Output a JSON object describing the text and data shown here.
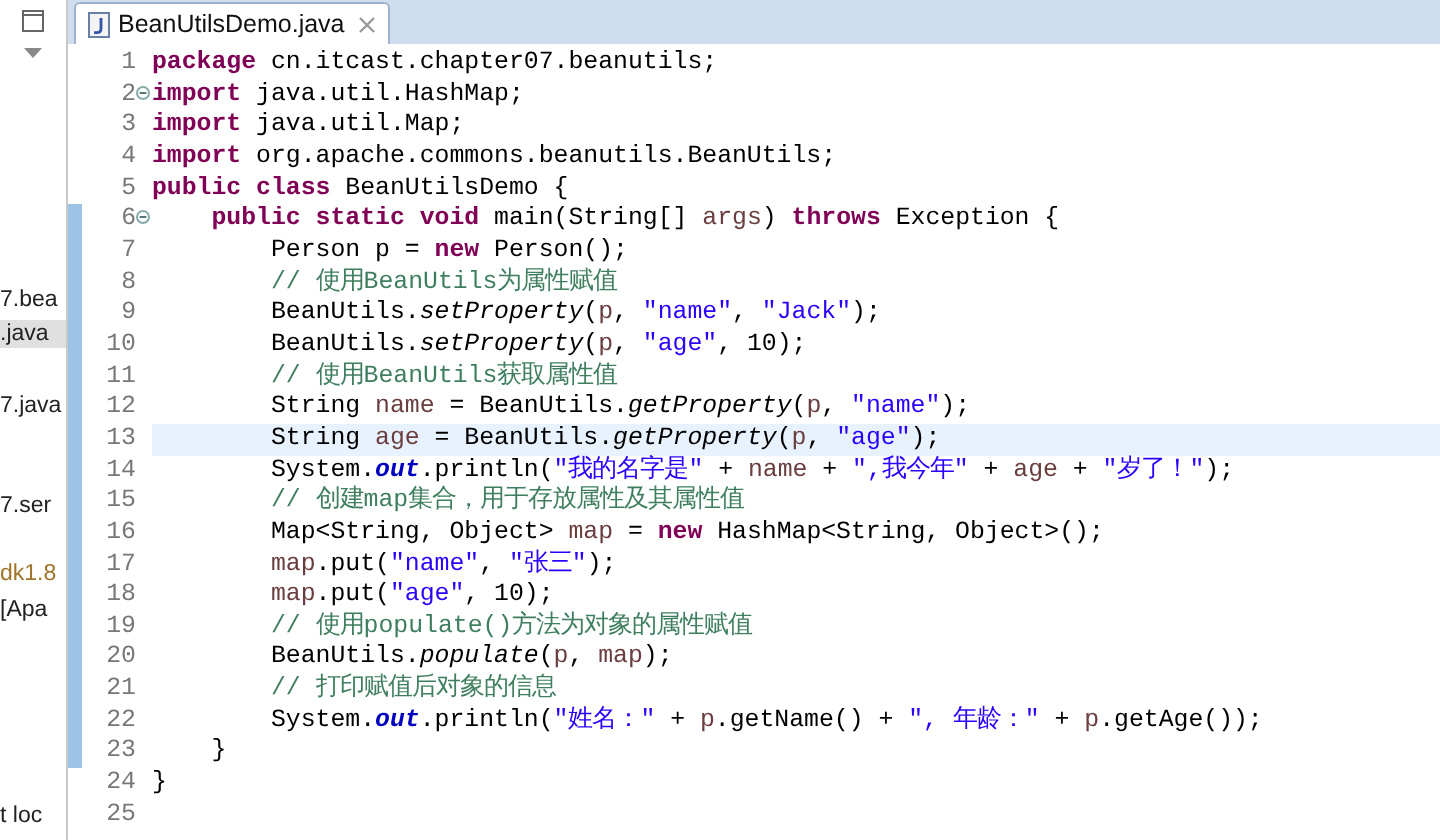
{
  "explorer": {
    "items": [
      {
        "label": "7.bea",
        "selected": false,
        "kind": "file"
      },
      {
        "label": ".java",
        "selected": true,
        "kind": "file"
      },
      {
        "label": "7.java",
        "selected": false,
        "kind": "file"
      },
      {
        "label": "7.ser",
        "selected": false,
        "kind": "file"
      },
      {
        "label": "dk1.8",
        "selected": false,
        "kind": "library"
      },
      {
        "label": "[Apa",
        "selected": false,
        "kind": "file"
      },
      {
        "label": "t loc",
        "selected": false,
        "kind": "file"
      }
    ]
  },
  "editor": {
    "tab": {
      "title": "BeanUtilsDemo.java",
      "selected": true
    },
    "lines": [
      {
        "number": "1",
        "changed": false,
        "current": false,
        "foldable": false,
        "tokens": [
          {
            "kind": "keyword",
            "text": "package"
          },
          {
            "kind": "plain",
            "text": " cn.itcast.chapter07.beanutils;"
          }
        ]
      },
      {
        "number": "2",
        "changed": false,
        "current": false,
        "foldable": true,
        "tokens": [
          {
            "kind": "keyword",
            "text": "import"
          },
          {
            "kind": "plain",
            "text": " java.util.HashMap;"
          }
        ]
      },
      {
        "number": "3",
        "changed": false,
        "current": false,
        "foldable": false,
        "tokens": [
          {
            "kind": "keyword",
            "text": "import"
          },
          {
            "kind": "plain",
            "text": " java.util.Map;"
          }
        ]
      },
      {
        "number": "4",
        "changed": false,
        "current": false,
        "foldable": false,
        "tokens": [
          {
            "kind": "keyword",
            "text": "import"
          },
          {
            "kind": "plain",
            "text": " org.apache.commons.beanutils.BeanUtils;"
          }
        ]
      },
      {
        "number": "5",
        "changed": false,
        "current": false,
        "foldable": false,
        "tokens": [
          {
            "kind": "keyword",
            "text": "public class"
          },
          {
            "kind": "plain",
            "text": " BeanUtilsDemo {"
          }
        ]
      },
      {
        "number": "6",
        "changed": true,
        "current": false,
        "foldable": true,
        "tokens": [
          {
            "kind": "keyword",
            "text": "    public static void"
          },
          {
            "kind": "plain",
            "text": " main(String[] "
          },
          {
            "kind": "variable",
            "text": "args"
          },
          {
            "kind": "plain",
            "text": ") "
          },
          {
            "kind": "keyword",
            "text": "throws"
          },
          {
            "kind": "plain",
            "text": " Exception {"
          }
        ]
      },
      {
        "number": "7",
        "changed": true,
        "current": false,
        "foldable": false,
        "tokens": [
          {
            "kind": "plain",
            "text": "        Person p = "
          },
          {
            "kind": "keyword",
            "text": "new"
          },
          {
            "kind": "plain",
            "text": " Person();"
          }
        ]
      },
      {
        "number": "8",
        "changed": true,
        "current": false,
        "foldable": false,
        "tokens": [
          {
            "kind": "comment",
            "text": "        // 使用BeanUtils为属性赋值"
          }
        ]
      },
      {
        "number": "9",
        "changed": true,
        "current": false,
        "foldable": false,
        "tokens": [
          {
            "kind": "plain",
            "text": "        BeanUtils."
          },
          {
            "kind": "static",
            "text": "setProperty"
          },
          {
            "kind": "plain",
            "text": "("
          },
          {
            "kind": "variable",
            "text": "p"
          },
          {
            "kind": "plain",
            "text": ", "
          },
          {
            "kind": "string",
            "text": "\"name\""
          },
          {
            "kind": "plain",
            "text": ", "
          },
          {
            "kind": "string",
            "text": "\"Jack\""
          },
          {
            "kind": "plain",
            "text": ");"
          }
        ]
      },
      {
        "number": "10",
        "changed": true,
        "current": false,
        "foldable": false,
        "tokens": [
          {
            "kind": "plain",
            "text": "        BeanUtils."
          },
          {
            "kind": "static",
            "text": "setProperty"
          },
          {
            "kind": "plain",
            "text": "("
          },
          {
            "kind": "variable",
            "text": "p"
          },
          {
            "kind": "plain",
            "text": ", "
          },
          {
            "kind": "string",
            "text": "\"age\""
          },
          {
            "kind": "plain",
            "text": ", 10);"
          }
        ]
      },
      {
        "number": "11",
        "changed": true,
        "current": false,
        "foldable": false,
        "tokens": [
          {
            "kind": "comment",
            "text": "        // 使用BeanUtils获取属性值"
          }
        ]
      },
      {
        "number": "12",
        "changed": true,
        "current": false,
        "foldable": false,
        "tokens": [
          {
            "kind": "plain",
            "text": "        String "
          },
          {
            "kind": "variable",
            "text": "name"
          },
          {
            "kind": "plain",
            "text": " = BeanUtils."
          },
          {
            "kind": "static",
            "text": "getProperty"
          },
          {
            "kind": "plain",
            "text": "("
          },
          {
            "kind": "variable",
            "text": "p"
          },
          {
            "kind": "plain",
            "text": ", "
          },
          {
            "kind": "string",
            "text": "\"name\""
          },
          {
            "kind": "plain",
            "text": ");"
          }
        ]
      },
      {
        "number": "13",
        "changed": true,
        "current": true,
        "foldable": false,
        "tokens": [
          {
            "kind": "plain",
            "text": "        String "
          },
          {
            "kind": "variable",
            "text": "age"
          },
          {
            "kind": "plain",
            "text": " = BeanUtils."
          },
          {
            "kind": "static",
            "text": "getProperty"
          },
          {
            "kind": "plain",
            "text": "("
          },
          {
            "kind": "variable",
            "text": "p"
          },
          {
            "kind": "plain",
            "text": ", "
          },
          {
            "kind": "string",
            "text": "\"age\""
          },
          {
            "kind": "plain",
            "text": ");"
          }
        ]
      },
      {
        "number": "14",
        "changed": true,
        "current": false,
        "foldable": false,
        "tokens": [
          {
            "kind": "plain",
            "text": "        System."
          },
          {
            "kind": "field",
            "text": "out"
          },
          {
            "kind": "plain",
            "text": ".println("
          },
          {
            "kind": "string",
            "text": "\"我的名字是\""
          },
          {
            "kind": "plain",
            "text": " + "
          },
          {
            "kind": "variable",
            "text": "name"
          },
          {
            "kind": "plain",
            "text": " + "
          },
          {
            "kind": "string",
            "text": "\",我今年\""
          },
          {
            "kind": "plain",
            "text": " + "
          },
          {
            "kind": "variable",
            "text": "age"
          },
          {
            "kind": "plain",
            "text": " + "
          },
          {
            "kind": "string",
            "text": "\"岁了！\""
          },
          {
            "kind": "plain",
            "text": ");"
          }
        ]
      },
      {
        "number": "15",
        "changed": true,
        "current": false,
        "foldable": false,
        "tokens": [
          {
            "kind": "comment",
            "text": "        // 创建map集合，用于存放属性及其属性值"
          }
        ]
      },
      {
        "number": "16",
        "changed": true,
        "current": false,
        "foldable": false,
        "tokens": [
          {
            "kind": "plain",
            "text": "        Map<String, Object> "
          },
          {
            "kind": "variable",
            "text": "map"
          },
          {
            "kind": "plain",
            "text": " = "
          },
          {
            "kind": "keyword",
            "text": "new"
          },
          {
            "kind": "plain",
            "text": " HashMap<String, Object>();"
          }
        ]
      },
      {
        "number": "17",
        "changed": true,
        "current": false,
        "foldable": false,
        "tokens": [
          {
            "kind": "variable",
            "text": "        map"
          },
          {
            "kind": "plain",
            "text": ".put("
          },
          {
            "kind": "string",
            "text": "\"name\""
          },
          {
            "kind": "plain",
            "text": ", "
          },
          {
            "kind": "string",
            "text": "\"张三\""
          },
          {
            "kind": "plain",
            "text": ");"
          }
        ]
      },
      {
        "number": "18",
        "changed": true,
        "current": false,
        "foldable": false,
        "tokens": [
          {
            "kind": "variable",
            "text": "        map"
          },
          {
            "kind": "plain",
            "text": ".put("
          },
          {
            "kind": "string",
            "text": "\"age\""
          },
          {
            "kind": "plain",
            "text": ", 10);"
          }
        ]
      },
      {
        "number": "19",
        "changed": true,
        "current": false,
        "foldable": false,
        "tokens": [
          {
            "kind": "comment",
            "text": "        // 使用populate()方法为对象的属性赋值"
          }
        ]
      },
      {
        "number": "20",
        "changed": true,
        "current": false,
        "foldable": false,
        "tokens": [
          {
            "kind": "plain",
            "text": "        BeanUtils."
          },
          {
            "kind": "static",
            "text": "populate"
          },
          {
            "kind": "plain",
            "text": "("
          },
          {
            "kind": "variable",
            "text": "p"
          },
          {
            "kind": "plain",
            "text": ", "
          },
          {
            "kind": "variable",
            "text": "map"
          },
          {
            "kind": "plain",
            "text": ");"
          }
        ]
      },
      {
        "number": "21",
        "changed": true,
        "current": false,
        "foldable": false,
        "tokens": [
          {
            "kind": "comment",
            "text": "        // 打印赋值后对象的信息"
          }
        ]
      },
      {
        "number": "22",
        "changed": true,
        "current": false,
        "foldable": false,
        "tokens": [
          {
            "kind": "plain",
            "text": "        System."
          },
          {
            "kind": "field",
            "text": "out"
          },
          {
            "kind": "plain",
            "text": ".println("
          },
          {
            "kind": "string",
            "text": "\"姓名：\""
          },
          {
            "kind": "plain",
            "text": " + "
          },
          {
            "kind": "variable",
            "text": "p"
          },
          {
            "kind": "plain",
            "text": ".getName() + "
          },
          {
            "kind": "string",
            "text": "\", 年龄：\""
          },
          {
            "kind": "plain",
            "text": " + "
          },
          {
            "kind": "variable",
            "text": "p"
          },
          {
            "kind": "plain",
            "text": ".getAge());"
          }
        ]
      },
      {
        "number": "23",
        "changed": true,
        "current": false,
        "foldable": false,
        "tokens": [
          {
            "kind": "plain",
            "text": "    }"
          }
        ]
      },
      {
        "number": "24",
        "changed": false,
        "current": false,
        "foldable": false,
        "tokens": [
          {
            "kind": "plain",
            "text": "}"
          }
        ]
      },
      {
        "number": "25",
        "changed": false,
        "current": false,
        "foldable": false
      }
    ]
  }
}
